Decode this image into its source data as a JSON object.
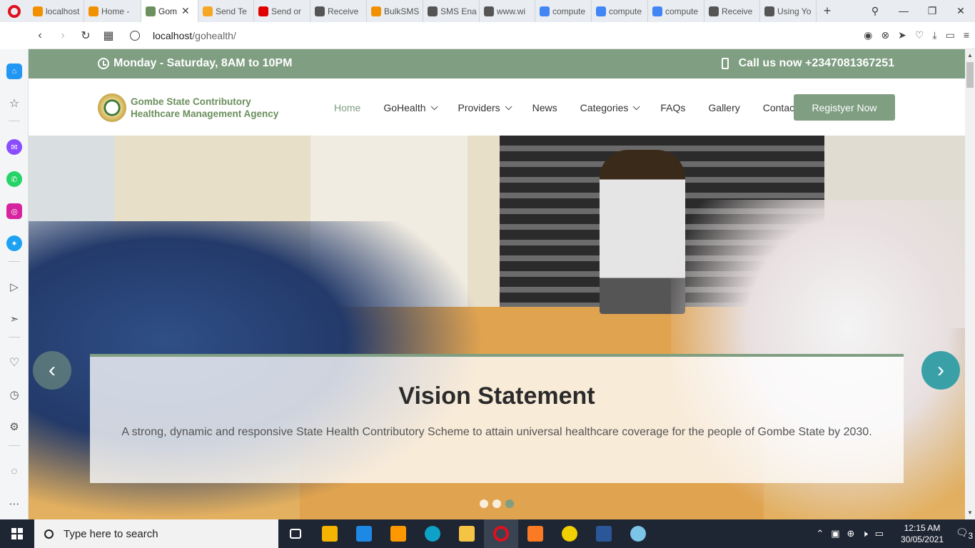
{
  "browser": {
    "tabs": [
      {
        "label": "localhost",
        "icon": "pma-icon",
        "color": "#f29100"
      },
      {
        "label": "Home -",
        "icon": "pma-icon",
        "color": "#f29100"
      },
      {
        "label": "Gom",
        "icon": "seal-icon",
        "color": "#6b8f5d",
        "active": true
      },
      {
        "label": "Send Te",
        "icon": "smile-icon",
        "color": "#f5a623"
      },
      {
        "label": "Send or",
        "icon": "youtube-icon",
        "color": "#e00000"
      },
      {
        "label": "Receive",
        "icon": "document-icon",
        "color": "#555555"
      },
      {
        "label": "BulkSMS",
        "icon": "bulksms-icon",
        "color": "#f29100"
      },
      {
        "label": "SMS Ena",
        "icon": "document-icon",
        "color": "#555555"
      },
      {
        "label": "www.wi",
        "icon": "document-icon",
        "color": "#555555"
      },
      {
        "label": "compute",
        "icon": "google-icon",
        "color": "#4285f4"
      },
      {
        "label": "compute",
        "icon": "google-icon",
        "color": "#4285f4"
      },
      {
        "label": "compute",
        "icon": "google-icon",
        "color": "#4285f4"
      },
      {
        "label": "Receive",
        "icon": "document-icon",
        "color": "#555555"
      },
      {
        "label": "Using Yo",
        "icon": "document-icon",
        "color": "#555555"
      }
    ],
    "url_host": "localhost",
    "url_path": "/gohealth/"
  },
  "site": {
    "hours": "Monday - Saturday, 8AM to 10PM",
    "call": "Call us now +2347081367251",
    "logo_line1": "Gombe State Contributory",
    "logo_line2": "Healthcare Management Agency",
    "menu": [
      {
        "label": "Home",
        "active": true,
        "dropdown": false
      },
      {
        "label": "GoHealth",
        "dropdown": true
      },
      {
        "label": "Providers",
        "dropdown": true
      },
      {
        "label": "News",
        "dropdown": false
      },
      {
        "label": "Categories",
        "dropdown": true
      },
      {
        "label": "FAQs",
        "dropdown": false
      },
      {
        "label": "Gallery",
        "dropdown": false
      },
      {
        "label": "Contact",
        "dropdown": false
      }
    ],
    "register_label": "Registyer Now",
    "slider": {
      "title": "Vision Statement",
      "text": "A strong, dynamic and responsive State Health Contributory Scheme to attain universal healthcare coverage for the people of Gombe State by 2030.",
      "slide_count": 3,
      "active_slide": 3
    }
  },
  "taskbar": {
    "search_placeholder": "Type here to search",
    "time": "12:15 AM",
    "date": "30/05/2021",
    "notifications": "3"
  },
  "colors": {
    "brand_green": "#7f9e82",
    "logo_green": "#6b8f5d",
    "slider_next": "#3aa0a8"
  }
}
